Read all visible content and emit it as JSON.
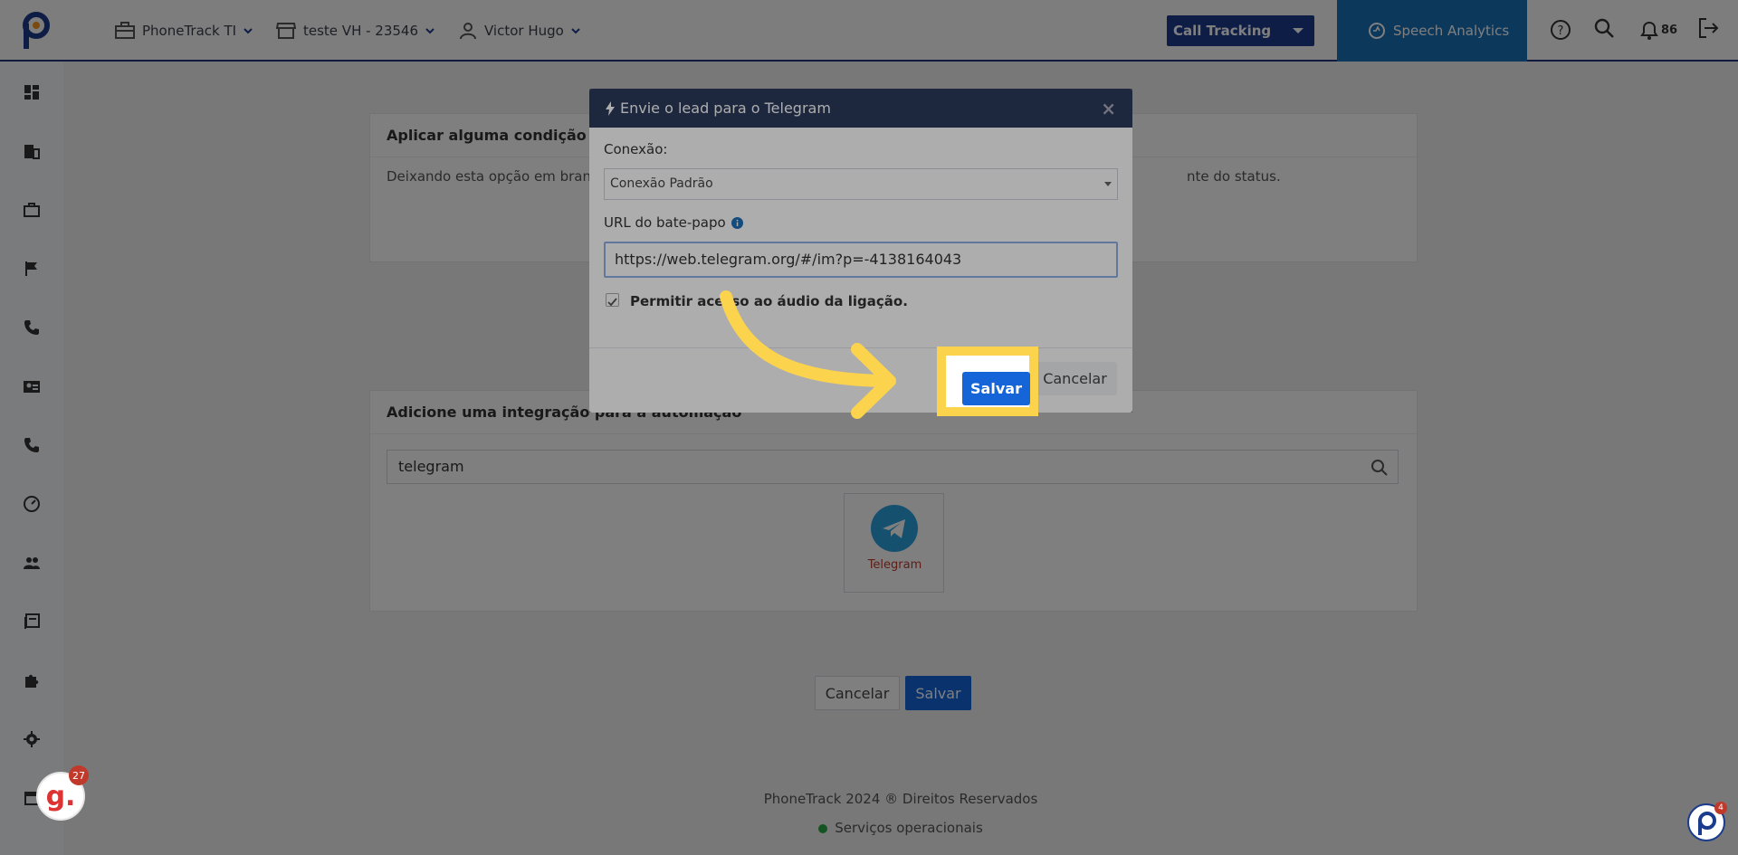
{
  "topbar": {
    "company": "PhoneTrack TI",
    "account": "teste VH - 23546",
    "user": "Victor Hugo",
    "product_select": "Call Tracking",
    "speech_tab": "Speech Analytics",
    "notifications_count": "86"
  },
  "sidebar": {
    "icons": [
      "dashboard-icon",
      "building-icon",
      "briefcase-icon",
      "flag-icon",
      "phone-icon",
      "contact-card-icon",
      "phone-icon",
      "speed-icon",
      "users-icon",
      "book-icon",
      "puzzle-icon",
      "gear-icon",
      "store-icon"
    ]
  },
  "main": {
    "condition_card": {
      "title": "Aplicar alguma condição para",
      "text_left": "Deixando esta opção em branco",
      "text_right": "nte do status."
    },
    "integration_card": {
      "title": "Adicione uma integração para a automação",
      "search_value": "telegram",
      "tile_label": "Telegram"
    },
    "cancel_label": "Cancelar",
    "save_label": "Salvar",
    "footer": {
      "copyright": "PhoneTrack 2024 ® Direitos Reservados",
      "status": "Serviços operacionais"
    }
  },
  "modal": {
    "title": "Envie o lead para o Telegram",
    "connection_label": "Conexão:",
    "connection_value": "Conexão Padrão",
    "url_label": "URL do bate-papo",
    "url_value": "https://web.telegram.org/#/im?p=-4138164043",
    "audio_checkbox_label": "Permitir acesso ao áudio da ligação.",
    "audio_checked": true,
    "save_label": "Salvar",
    "cancel_label": "Cancelar"
  },
  "widgets": {
    "g_badge": "27",
    "g_letter": "g.",
    "p_badge": "4"
  },
  "colors": {
    "brand_navy": "#1b3b8c",
    "speech_blue": "#1870b8",
    "primary": "#1565d8",
    "highlight": "#fcd34d",
    "arrow": "#fcd34d",
    "modal_header": "#2b3a5c"
  }
}
